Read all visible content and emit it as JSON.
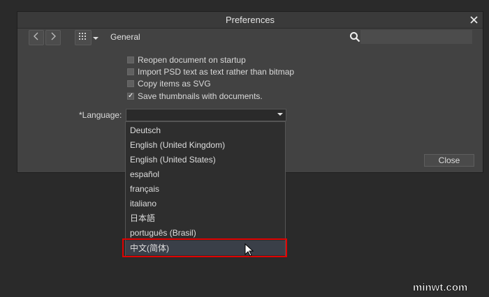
{
  "window": {
    "title": "Preferences"
  },
  "toolbar": {
    "section": "General",
    "search_value": ""
  },
  "options": [
    {
      "label": "Reopen document on startup",
      "checked": false
    },
    {
      "label": "Import PSD text as text rather than bitmap",
      "checked": false
    },
    {
      "label": "Copy items as SVG",
      "checked": false
    },
    {
      "label": "Save thumbnails with documents.",
      "checked": true
    }
  ],
  "language": {
    "label": "*Language:",
    "selected": "",
    "options": [
      "Deutsch",
      "English (United Kingdom)",
      "English (United States)",
      "español",
      "français",
      "italiano",
      "日本語",
      "português (Brasil)",
      "中文(简体)"
    ],
    "hovered_index": 8
  },
  "buttons": {
    "close": "Close"
  },
  "watermark": {
    "text": "minwt.com"
  },
  "colors": {
    "highlight_border": "#e00000",
    "dialog_bg": "#424242",
    "desktop_bg": "#2a2a2a"
  }
}
